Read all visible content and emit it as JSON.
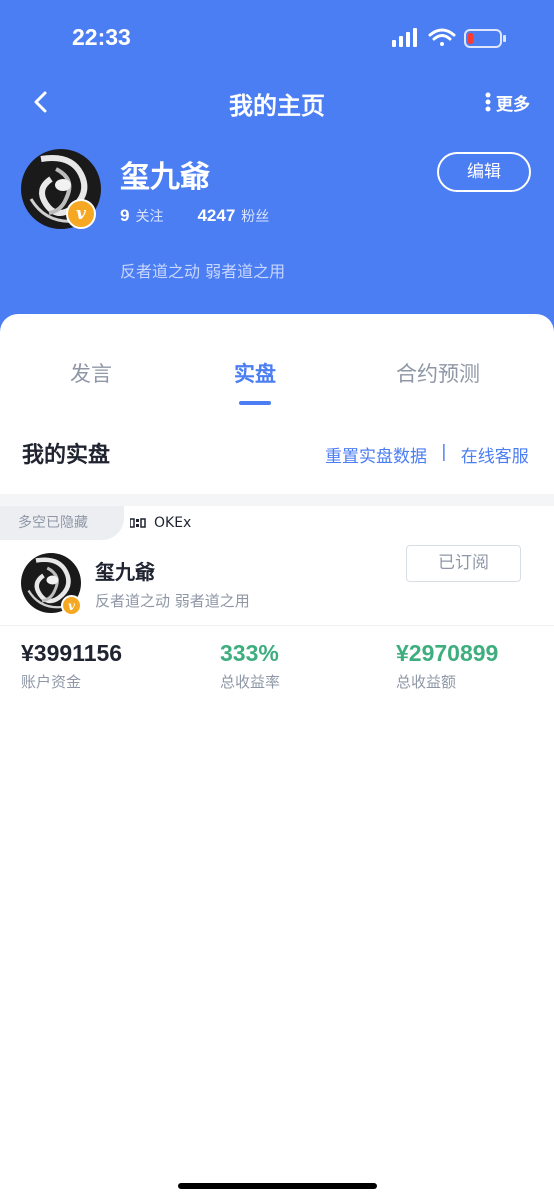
{
  "status_bar": {
    "time": "22:33"
  },
  "nav": {
    "title": "我的主页",
    "more_label": "更多"
  },
  "profile": {
    "name": "玺九爺",
    "badge": "v",
    "following_count": "9",
    "following_label": "关注",
    "followers_count": "4247",
    "followers_label": "粉丝",
    "bio": "反者道之动 弱者道之用",
    "edit_label": "编辑"
  },
  "tabs": [
    {
      "label": "发言",
      "active": false
    },
    {
      "label": "实盘",
      "active": true
    },
    {
      "label": "合约预测",
      "active": false
    }
  ],
  "section": {
    "title": "我的实盘",
    "reset_link": "重置实盘数据",
    "separator": "|",
    "service_link": "在线客服"
  },
  "portfolio": {
    "hidden_tag": "多空已隐藏",
    "exchange": "OKEx",
    "name": "玺九爺",
    "badge": "v",
    "bio": "反者道之动 弱者道之用",
    "subscribe_label": "已订阅",
    "metrics": [
      {
        "value": "¥3991156",
        "label": "账户资金",
        "color": "#1f2430"
      },
      {
        "value": "333%",
        "label": "总收益率",
        "color": "#3fae7f"
      },
      {
        "value": "¥2970899",
        "label": "总收益额",
        "color": "#3fae7f"
      }
    ]
  },
  "colors": {
    "primary": "#4b7df3",
    "profit": "#3fae7f",
    "badge": "#f7a823"
  }
}
